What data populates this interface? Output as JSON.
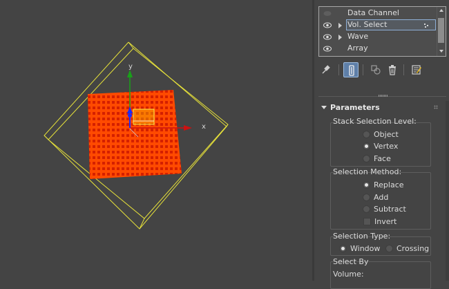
{
  "viewport": {
    "gizmo": {
      "x_axis_label": "x",
      "y_axis_label": "y"
    },
    "colors": {
      "bbox": "#e6e13a",
      "plane_fill": "#ff4a00",
      "plane_dots": "#cc1800",
      "x_axis": "#cc1111",
      "y_axis": "#19a019",
      "z_axis": "#1a2cff"
    }
  },
  "modifier_stack": {
    "items": [
      {
        "label": "Data Channel",
        "visible": false,
        "expandable": false,
        "selected": false
      },
      {
        "label": "Vol. Select",
        "visible": true,
        "expandable": true,
        "selected": true
      },
      {
        "label": "Wave",
        "visible": true,
        "expandable": true,
        "selected": false
      },
      {
        "label": "Array",
        "visible": true,
        "expandable": false,
        "selected": false
      }
    ]
  },
  "toolbar": {
    "buttons": [
      "pin-stack-icon",
      "show-end-result-icon",
      "make-unique-icon",
      "remove-modifier-icon",
      "configure-sets-icon"
    ],
    "active": "show-end-result-icon"
  },
  "parameters": {
    "title": "Parameters",
    "stack_selection_level": {
      "title": "Stack Selection Level:",
      "options": [
        "Object",
        "Vertex",
        "Face"
      ],
      "selected": "Vertex"
    },
    "selection_method": {
      "title": "Selection Method:",
      "options": [
        "Replace",
        "Add",
        "Subtract"
      ],
      "selected": "Replace",
      "invert_label": "Invert",
      "invert_checked": false
    },
    "selection_type": {
      "title": "Selection Type:",
      "options": [
        "Window",
        "Crossing"
      ],
      "selected": "Window"
    },
    "select_by": {
      "title": "Select By",
      "volume_label": "Volume:"
    }
  }
}
